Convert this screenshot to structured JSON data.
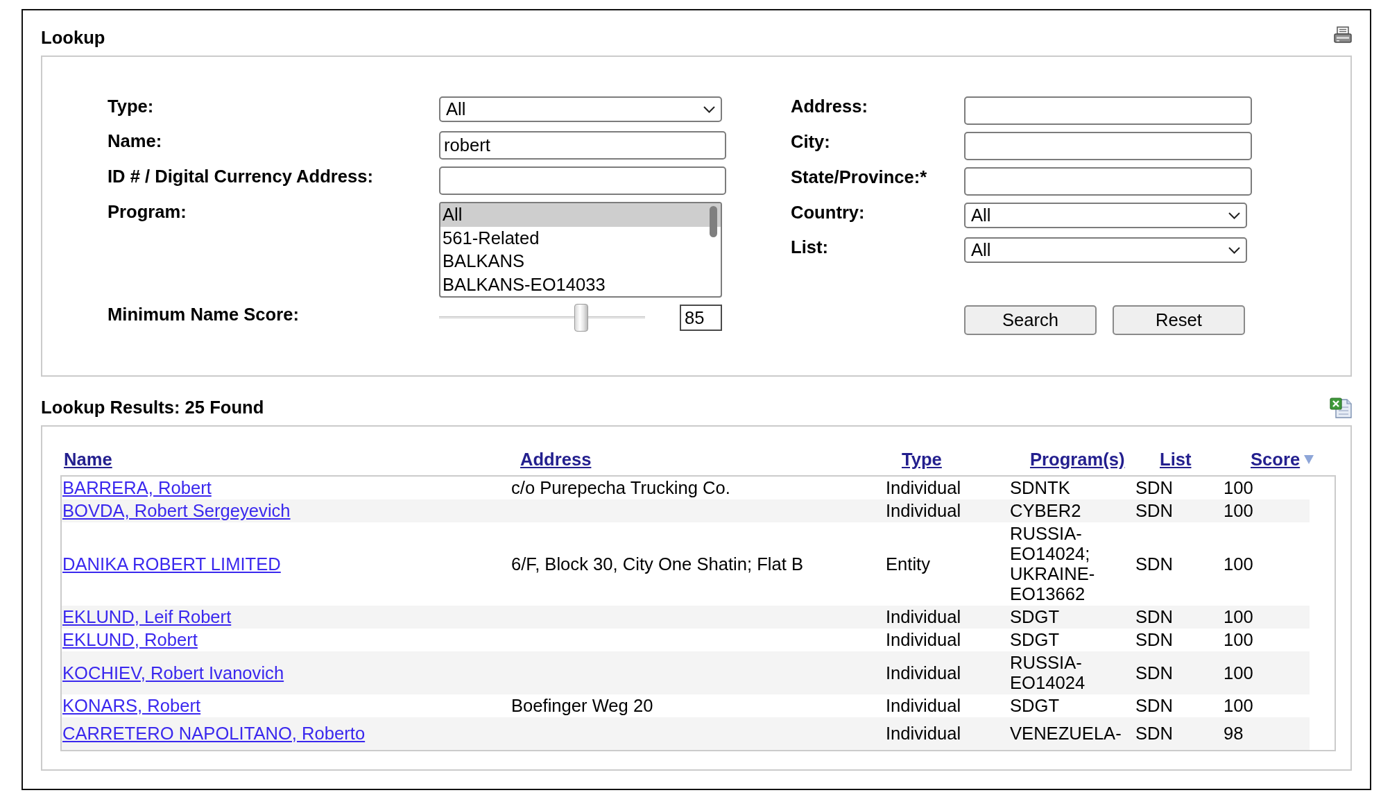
{
  "lookup": {
    "title": "Lookup",
    "form": {
      "left_fields": [
        {
          "kind": "select",
          "label": "Type:",
          "value": "All"
        },
        {
          "kind": "text",
          "label": "Name:",
          "value": "robert"
        },
        {
          "kind": "text",
          "label": "ID # / Digital Currency Address:"
        },
        {
          "kind": "listbox",
          "label": "Program:",
          "options": [
            {
              "label": "All",
              "selected": true
            },
            {
              "label": "561-Related",
              "selected": false
            },
            {
              "label": "BALKANS",
              "selected": false
            },
            {
              "label": "BALKANS-EO14033",
              "selected": false
            }
          ]
        },
        {
          "kind": "slider",
          "label": "Minimum Name Score:",
          "level": 0.69,
          "value": "85"
        }
      ],
      "right_fields": [
        {
          "kind": "text",
          "label": "Address:"
        },
        {
          "kind": "text",
          "label": "City:"
        },
        {
          "kind": "text",
          "label": "State/Province:*"
        },
        {
          "kind": "select",
          "label": "Country:",
          "value": "All"
        },
        {
          "kind": "select",
          "label": "List:",
          "value": "All"
        }
      ],
      "buttons": [
        "Search",
        "Reset"
      ]
    }
  },
  "results": {
    "title": "Lookup Results: 25 Found",
    "columns": [
      {
        "label": "Name",
        "sorted": false
      },
      {
        "label": "Address",
        "sorted": false
      },
      {
        "label": "Type",
        "sorted": false
      },
      {
        "label": "Program(s)",
        "sorted": false
      },
      {
        "label": "List",
        "sorted": false
      },
      {
        "label": "Score",
        "sorted": true
      }
    ],
    "rows": [
      {
        "name": "BARRERA, Robert",
        "address": "c/o Purepecha Trucking Co.",
        "type": "Individual",
        "programs": "SDNTK",
        "list": "SDN",
        "score": "100"
      },
      {
        "name": "BOVDA, Robert Sergeyevich",
        "type": "Individual",
        "programs": "CYBER2",
        "list": "SDN",
        "score": "100"
      },
      {
        "name": "DANIKA ROBERT LIMITED",
        "address": "6/F, Block 30, City One Shatin; Flat B",
        "type": "Entity",
        "programs": "RUSSIA-EO14024; UKRAINE-EO13662",
        "list": "SDN",
        "score": "100"
      },
      {
        "name": "EKLUND, Leif Robert",
        "type": "Individual",
        "programs": "SDGT",
        "list": "SDN",
        "score": "100"
      },
      {
        "name": "EKLUND, Robert",
        "type": "Individual",
        "programs": "SDGT",
        "list": "SDN",
        "score": "100"
      },
      {
        "name": "KOCHIEV, Robert Ivanovich",
        "type": "Individual",
        "programs": "RUSSIA-EO14024",
        "list": "SDN",
        "score": "100"
      },
      {
        "name": "KONARS, Robert",
        "address": "Boefinger Weg 20",
        "type": "Individual",
        "programs": "SDGT",
        "list": "SDN",
        "score": "100"
      },
      {
        "name": "CARRETERO NAPOLITANO, Roberto",
        "type": "Individual",
        "programs": "VENEZUELA-",
        "list": "SDN",
        "score": "98"
      }
    ]
  }
}
